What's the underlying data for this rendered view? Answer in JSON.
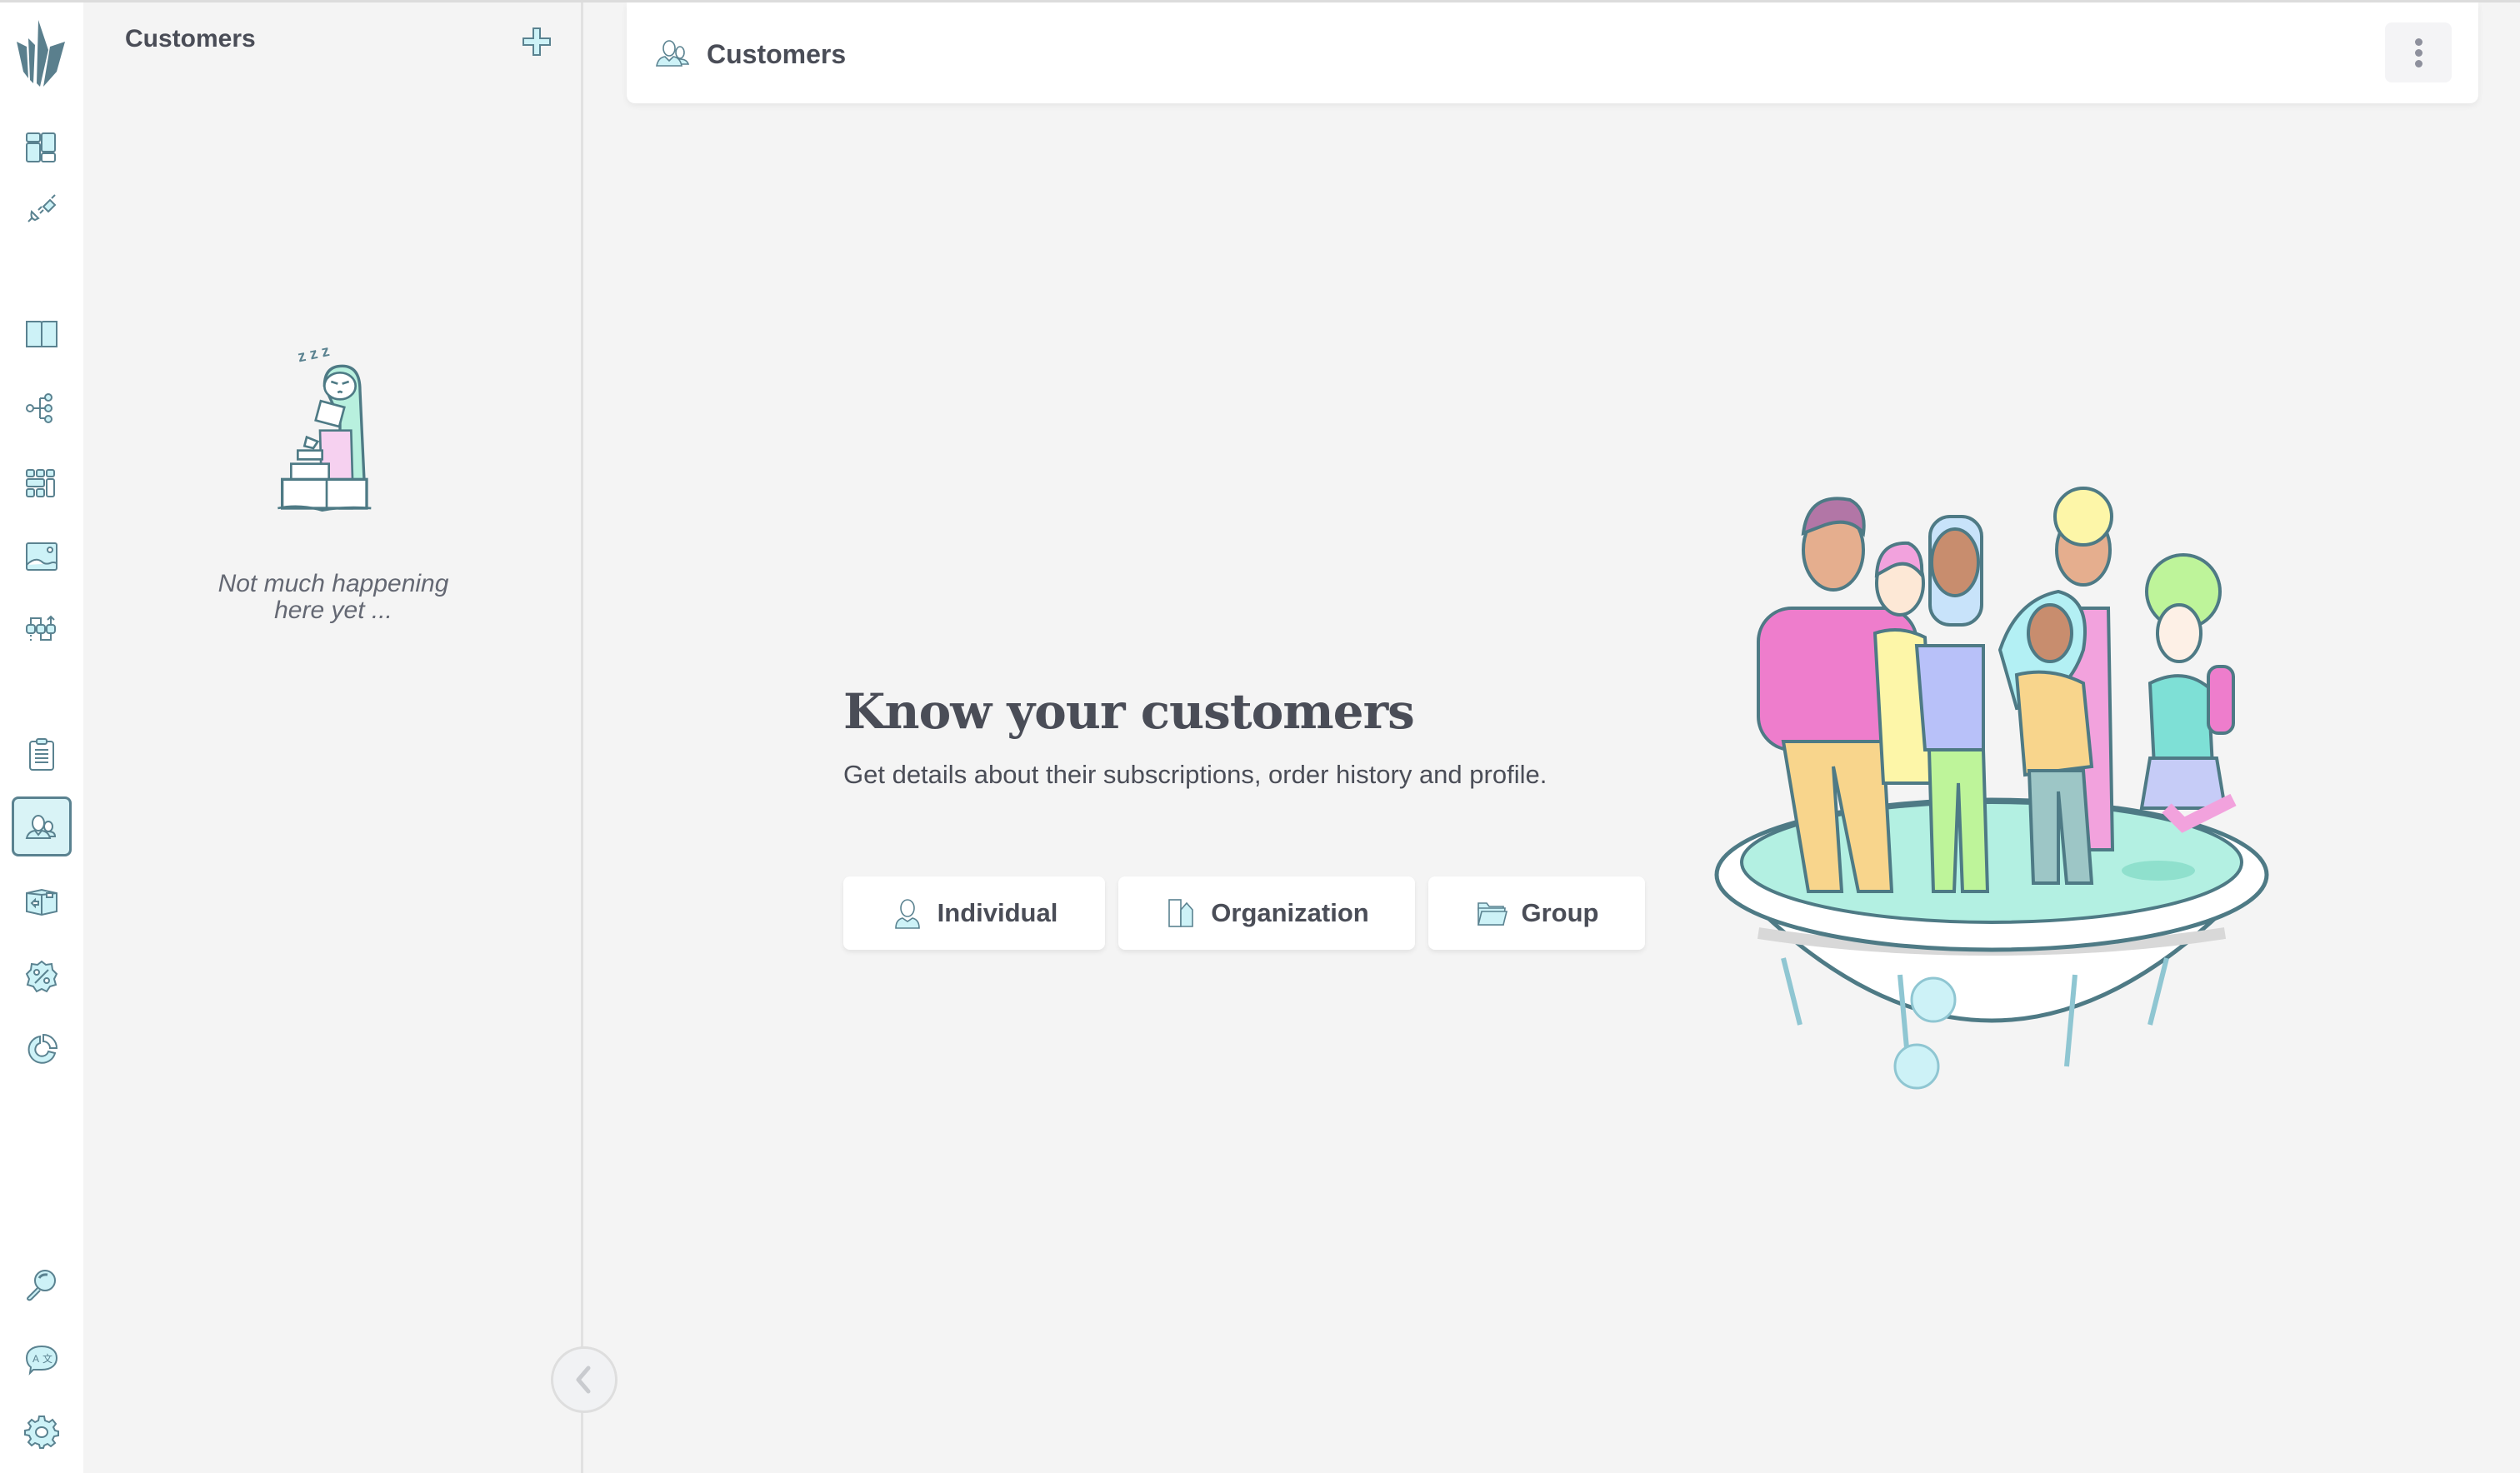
{
  "app": {
    "logo": "crystal-logo"
  },
  "rail": {
    "items": [
      {
        "name": "dashboard",
        "icon": "dashboard-icon"
      },
      {
        "name": "integrations",
        "icon": "plug-icon"
      },
      {
        "name": "documentation",
        "icon": "book-icon"
      },
      {
        "name": "workflows",
        "icon": "tree-icon"
      },
      {
        "name": "layouts",
        "icon": "grid-icon"
      },
      {
        "name": "media",
        "icon": "image-icon"
      },
      {
        "name": "flows",
        "icon": "flow-icon"
      },
      {
        "name": "orders",
        "icon": "clipboard-icon"
      },
      {
        "name": "customers",
        "icon": "customers-icon",
        "active": true
      },
      {
        "name": "products",
        "icon": "box-icon"
      },
      {
        "name": "discounts",
        "icon": "discount-icon"
      },
      {
        "name": "reports",
        "icon": "pie-icon"
      },
      {
        "name": "search",
        "icon": "search-icon"
      },
      {
        "name": "translations",
        "icon": "translate-icon"
      },
      {
        "name": "settings",
        "icon": "gear-icon"
      }
    ]
  },
  "panel": {
    "title": "Customers",
    "add_icon": "plus-icon",
    "empty_text_line1": "Not much happening",
    "empty_text_line2": "here yet ...",
    "collapse_icon": "chevron-left-icon"
  },
  "header": {
    "title": "Customers",
    "icon": "customers-icon",
    "menu_icon": "kebab-icon"
  },
  "hero": {
    "title": "Know your customers",
    "subtitle": "Get details about their subscriptions, order history and profile.",
    "buttons": [
      {
        "label": "Individual",
        "icon": "person-icon"
      },
      {
        "label": "Organization",
        "icon": "building-icon"
      },
      {
        "label": "Group",
        "icon": "folder-icon"
      }
    ]
  },
  "colors": {
    "icon_stroke": "#5a8290",
    "icon_fill": "#cdf2f7",
    "text": "#4a4d57",
    "background": "#f4f4f4"
  }
}
